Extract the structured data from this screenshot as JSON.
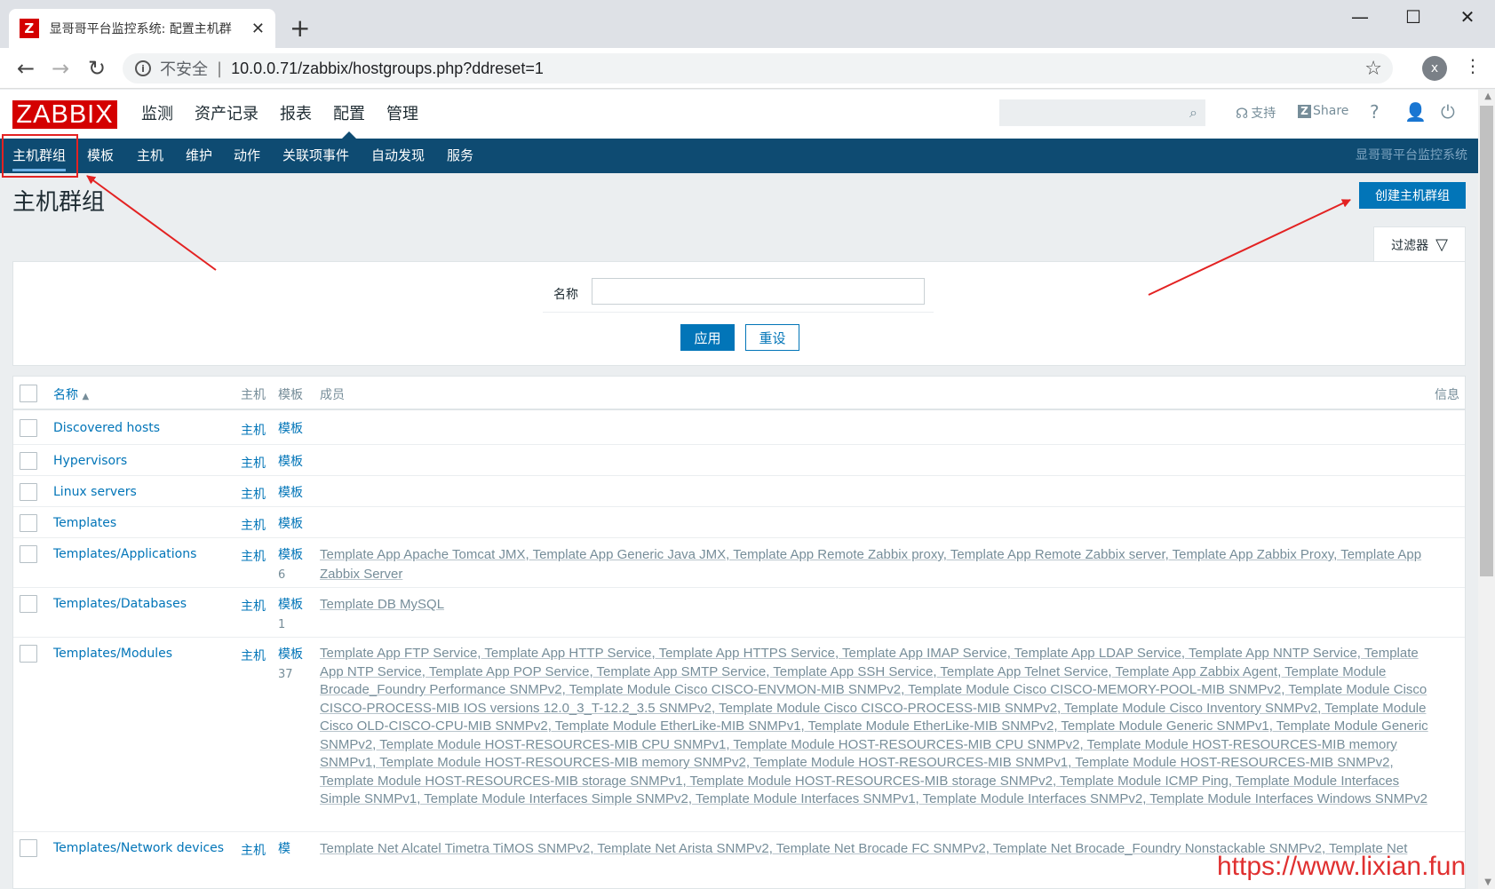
{
  "browser": {
    "tab_title": "显哥哥平台监控系统: 配置主机群",
    "tab_close": "✕",
    "favicon": "Z",
    "new_tab": "+",
    "insecure_label": "不安全",
    "separator": "|",
    "url": "10.0.0.71/zabbix/hostgroups.php?ddreset=1",
    "profile_initial": "x",
    "win_minimize": "—",
    "win_maximize": "☐",
    "win_close": "✕"
  },
  "zabbix": {
    "logo": "ZABBIX",
    "main_menu": [
      "监测",
      "资产记录",
      "报表",
      "配置",
      "管理"
    ],
    "active_main": "配置",
    "support": "支持",
    "share": "Share",
    "help": "?",
    "sub_menu": [
      "主机群组",
      "模板",
      "主机",
      "维护",
      "动作",
      "关联项事件",
      "自动发现",
      "服务"
    ],
    "server_name": "显哥哥平台监控系统"
  },
  "page": {
    "title": "主机群组",
    "create_button": "创建主机群组",
    "filter_tab": "过滤器"
  },
  "filter": {
    "name_label": "名称",
    "name_value": "",
    "apply": "应用",
    "reset": "重设"
  },
  "table": {
    "headers": {
      "name": "名称",
      "sort": "▲",
      "hosts": "主机",
      "templates": "模板",
      "members": "成员",
      "info": "信息"
    },
    "rows": [
      {
        "name": "Discovered hosts",
        "hosts": "主机",
        "templates": "模板",
        "count": "",
        "members": ""
      },
      {
        "name": "Hypervisors",
        "hosts": "主机",
        "templates": "模板",
        "count": "",
        "members": ""
      },
      {
        "name": "Linux servers",
        "hosts": "主机",
        "templates": "模板",
        "count": "",
        "members": ""
      },
      {
        "name": "Templates",
        "hosts": "主机",
        "templates": "模板",
        "count": "",
        "members": ""
      },
      {
        "name": "Templates/Applications",
        "hosts": "主机",
        "templates": "模板",
        "count": "6",
        "members": "Template App Apache Tomcat JMX, Template App Generic Java JMX, Template App Remote Zabbix proxy, Template App Remote Zabbix server, Template App Zabbix Proxy, Template App Zabbix Server"
      },
      {
        "name": "Templates/Databases",
        "hosts": "主机",
        "templates": "模板",
        "count": "1",
        "members": "Template DB MySQL"
      },
      {
        "name": "Templates/Modules",
        "hosts": "主机",
        "templates": "模板",
        "count": "37",
        "members": "Template App FTP Service, Template App HTTP Service, Template App HTTPS Service, Template App IMAP Service, Template App LDAP Service, Template App NNTP Service, Template App NTP Service, Template App POP Service, Template App SMTP Service, Template App SSH Service, Template App Telnet Service, Template App Zabbix Agent, Template Module Brocade_Foundry Performance SNMPv2, Template Module Cisco CISCO-ENVMON-MIB SNMPv2, Template Module Cisco CISCO-MEMORY-POOL-MIB SNMPv2, Template Module Cisco CISCO-PROCESS-MIB IOS versions 12.0_3_T-12.2_3.5 SNMPv2, Template Module Cisco CISCO-PROCESS-MIB SNMPv2, Template Module Cisco Inventory SNMPv2, Template Module Cisco OLD-CISCO-CPU-MIB SNMPv2, Template Module EtherLike-MIB SNMPv1, Template Module EtherLike-MIB SNMPv2, Template Module Generic SNMPv1, Template Module Generic SNMPv2, Template Module HOST-RESOURCES-MIB CPU SNMPv1, Template Module HOST-RESOURCES-MIB CPU SNMPv2, Template Module HOST-RESOURCES-MIB memory SNMPv1, Template Module HOST-RESOURCES-MIB memory SNMPv2, Template Module HOST-RESOURCES-MIB SNMPv1, Template Module HOST-RESOURCES-MIB SNMPv2, Template Module HOST-RESOURCES-MIB storage SNMPv1, Template Module HOST-RESOURCES-MIB storage SNMPv2, Template Module ICMP Ping, Template Module Interfaces Simple SNMPv1, Template Module Interfaces Simple SNMPv2, Template Module Interfaces SNMPv1, Template Module Interfaces SNMPv2, Template Module Interfaces Windows SNMPv2"
      },
      {
        "name": "Templates/Network devices",
        "hosts": "主机",
        "templates": "模",
        "count": "",
        "members": "Template Net Alcatel Timetra TiMOS SNMPv2, Template Net Arista SNMPv2, Template Net Brocade FC SNMPv2, Template Net Brocade_Foundry Nonstackable SNMPv2, Template Net"
      }
    ]
  },
  "watermark": "https://www.lixian.fun",
  "colors": {
    "brand": "#d40000",
    "nav": "#0e4b72",
    "link": "#0275b8",
    "annotation": "#e32222"
  }
}
